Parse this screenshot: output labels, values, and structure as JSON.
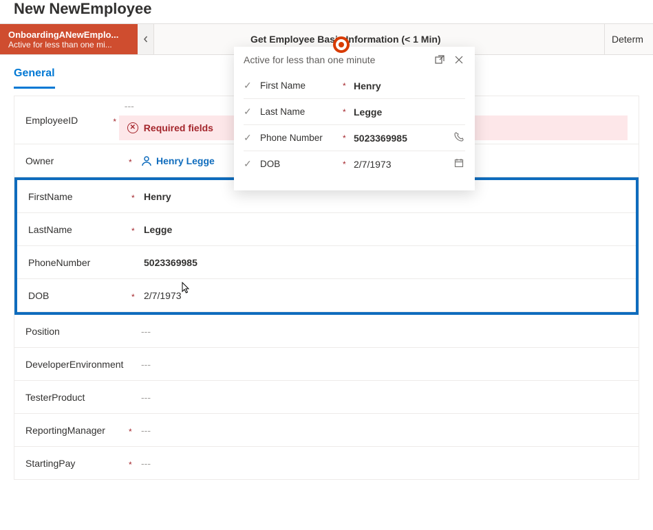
{
  "header": {
    "page_title": "New NewEmployee"
  },
  "stages": {
    "current_name": "OnboardingANewEmplo...",
    "current_sub": "Active for less than one mi...",
    "next_label": "Get Employee Basic Information  (< 1 Min)",
    "more_label": "Determ"
  },
  "tabs": {
    "general": "General"
  },
  "form": {
    "empty": "---",
    "employee_id_label": "EmployeeID",
    "error_text": "Required fields",
    "owner_label": "Owner",
    "owner_value": "Henry Legge",
    "firstname_label": "FirstName",
    "firstname_value": "Henry",
    "lastname_label": "LastName",
    "lastname_value": "Legge",
    "phone_label": "PhoneNumber",
    "phone_value": "5023369985",
    "dob_label": "DOB",
    "dob_value": "2/7/1973",
    "position_label": "Position",
    "devenv_label": "DeveloperEnvironment",
    "tester_label": "TesterProduct",
    "mgr_label": "ReportingManager",
    "pay_label": "StartingPay"
  },
  "flyout": {
    "title": "Active for less than one minute",
    "firstname_label": "First Name",
    "firstname_value": "Henry",
    "lastname_label": "Last Name",
    "lastname_value": "Legge",
    "phone_label": "Phone Number",
    "phone_value": "5023369985",
    "dob_label": "DOB",
    "dob_value": "2/7/1973"
  }
}
